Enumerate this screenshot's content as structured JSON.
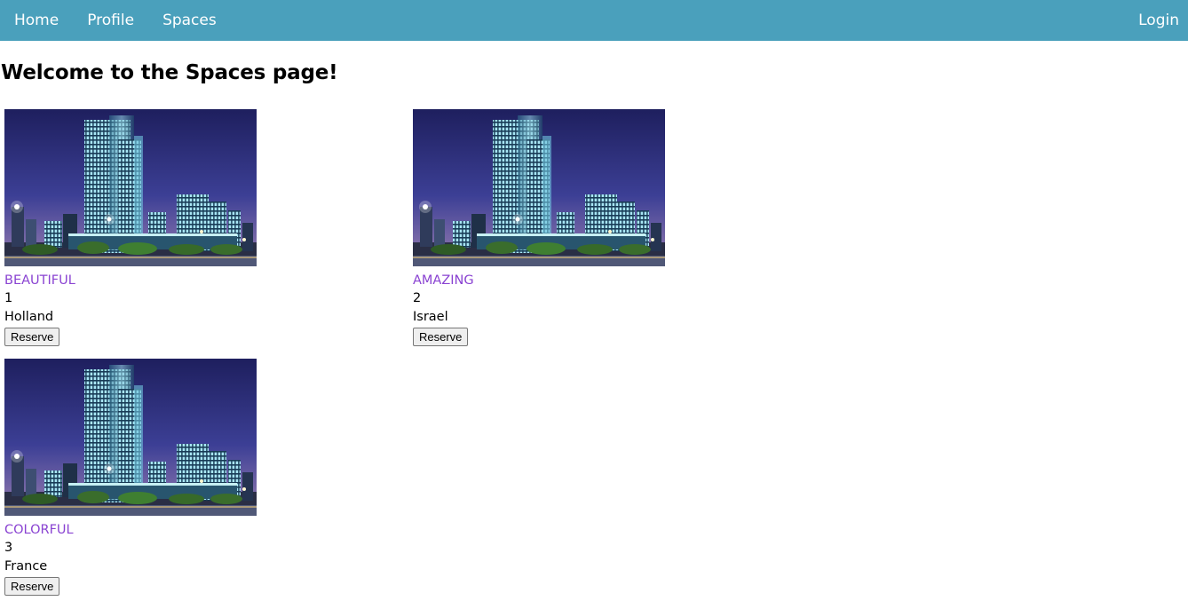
{
  "nav": {
    "home": "Home",
    "profile": "Profile",
    "spaces": "Spaces",
    "login": "Login"
  },
  "page": {
    "title": "Welcome to the Spaces page!"
  },
  "colors": {
    "navbar": "#4aa0bc",
    "link": "#8a43d2"
  },
  "spaces": [
    {
      "name": "BEAUTIFUL",
      "id": "1",
      "country": "Holland",
      "button": "Reserve",
      "image": "city-skyscraper-night-photo"
    },
    {
      "name": "AMAZING",
      "id": "2",
      "country": "Israel",
      "button": "Reserve",
      "image": "city-skyscraper-night-photo"
    },
    {
      "name": "COLORFUL",
      "id": "3",
      "country": "France",
      "button": "Reserve",
      "image": "city-skyscraper-night-photo"
    }
  ]
}
